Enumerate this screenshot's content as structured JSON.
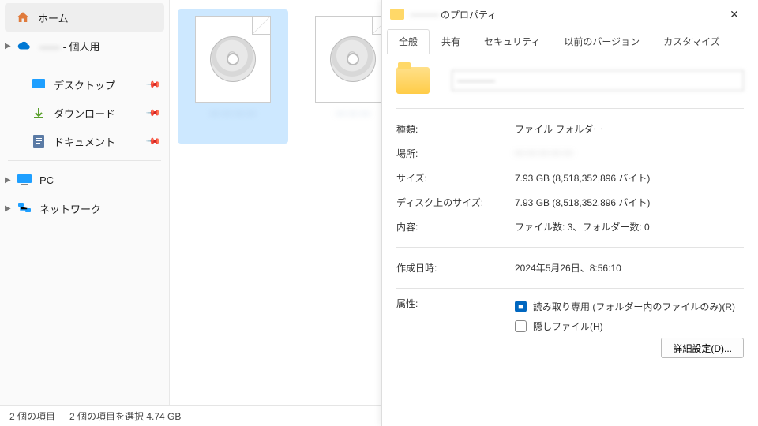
{
  "sidebar": {
    "home": "ホーム",
    "personal_suffix": " - 個人用",
    "desktop": "デスクトップ",
    "downloads": "ダウンロード",
    "documents": "ドキュメント",
    "pc": "PC",
    "network": "ネットワーク"
  },
  "files": {
    "item1": "— — — —",
    "item2": "— — —"
  },
  "statusbar": {
    "count": "2 個の項目",
    "selection": "2 個の項目を選択 4.74 GB"
  },
  "dialog": {
    "title_suffix": "のプロパティ",
    "close": "✕",
    "tabs": {
      "general": "全般",
      "sharing": "共有",
      "security": "セキュリティ",
      "previous": "以前のバージョン",
      "customize": "カスタマイズ"
    },
    "name_value": "————",
    "rows": {
      "type_label": "種類:",
      "type_value": "ファイル フォルダー",
      "location_label": "場所:",
      "location_value": "— — — — —",
      "size_label": "サイズ:",
      "size_value": "7.93 GB (8,518,352,896 バイト)",
      "disk_label": "ディスク上のサイズ:",
      "disk_value": "7.93 GB (8,518,352,896 バイト)",
      "contents_label": "内容:",
      "contents_value": "ファイル数: 3、フォルダー数: 0",
      "created_label": "作成日時:",
      "created_value": "2024年5月26日、8:56:10",
      "attr_label": "属性:",
      "readonly": "読み取り専用 (フォルダー内のファイルのみ)(R)",
      "hidden": "隠しファイル(H)",
      "advanced": "詳細設定(D)..."
    }
  }
}
